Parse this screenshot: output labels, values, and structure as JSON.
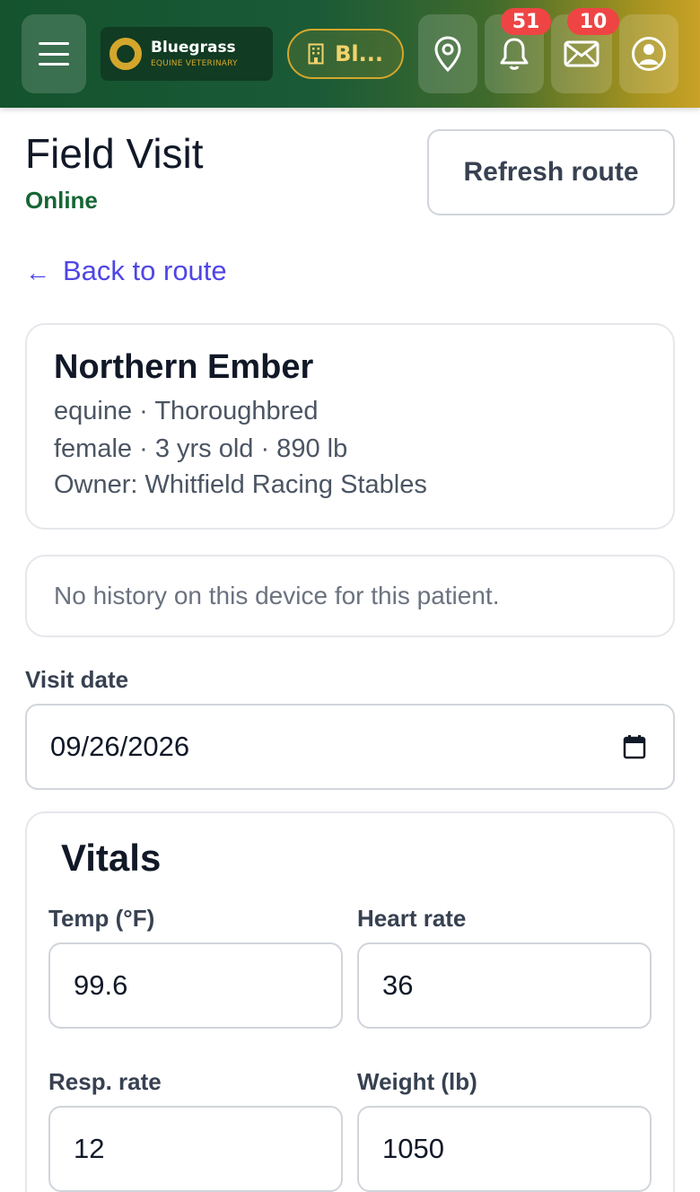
{
  "header": {
    "brand_name": "Bluegrass",
    "brand_subtitle": "EQUINE VETERINARY",
    "clinic_label": "Bl...",
    "notifications_count": "51",
    "messages_count": "10",
    "accent_color": "#d4a72c",
    "icons": [
      "menu-icon",
      "building-icon",
      "map-pin-icon",
      "bell-icon",
      "mail-icon",
      "user-circle-icon"
    ]
  },
  "page": {
    "title": "Field Visit",
    "status": "Online",
    "refresh_label": "Refresh route",
    "back_label": "Back to route",
    "back_arrow": "←"
  },
  "patient": {
    "name": "Northern Ember",
    "species_breed": "equine · Thoroughbred",
    "sex_age_weight": "female · 3 yrs old · 890 lb",
    "owner": "Owner: Whitfield Racing Stables"
  },
  "history": {
    "message": "No history on this device for this patient."
  },
  "visit": {
    "date_label": "Visit date",
    "date_value": "09/26/2026"
  },
  "vitals": {
    "title": "Vitals",
    "temp": {
      "label": "Temp (°F)",
      "value": "99.6"
    },
    "heart_rate": {
      "label": "Heart rate",
      "value": "36"
    },
    "resp_rate": {
      "label": "Resp. rate",
      "value": "12"
    },
    "weight": {
      "label": "Weight (lb)",
      "value": "1050"
    }
  }
}
